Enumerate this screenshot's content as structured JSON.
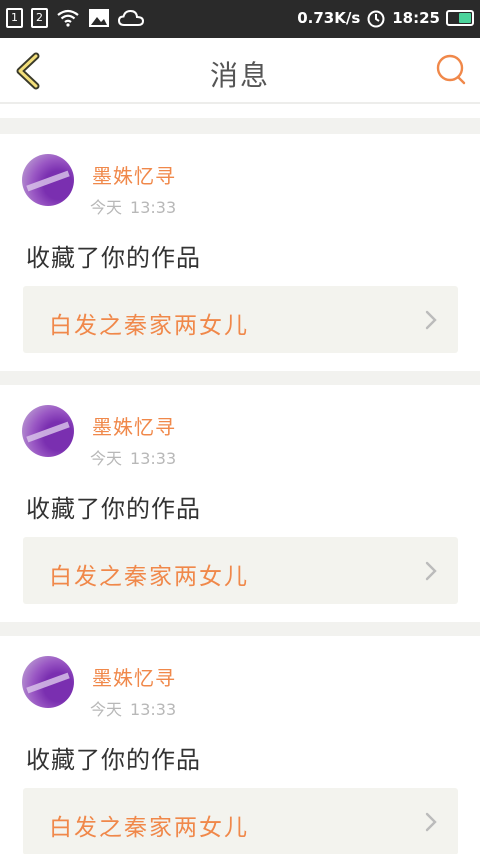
{
  "status_bar": {
    "sim1": "1",
    "sim2": "2",
    "net_speed": "0.73K/s",
    "time": "18:25",
    "icons": [
      "sim-icon",
      "wifi-icon",
      "image-icon",
      "cloud-icon",
      "alarm-icon",
      "battery-icon"
    ]
  },
  "header": {
    "title": "消息",
    "back_icon": "chevron-left-icon",
    "search_icon": "search-icon",
    "accent_color": "#f0884a"
  },
  "messages": [
    {
      "user": "墨姝忆寻",
      "day": "今天",
      "time": "13:33",
      "action": "收藏了你的作品",
      "work": "白发之秦家两女儿"
    },
    {
      "user": "墨姝忆寻",
      "day": "今天",
      "time": "13:33",
      "action": "收藏了你的作品",
      "work": "白发之秦家两女儿"
    },
    {
      "user": "墨姝忆寻",
      "day": "今天",
      "time": "13:33",
      "action": "收藏了你的作品",
      "work": "白发之秦家两女儿"
    }
  ]
}
